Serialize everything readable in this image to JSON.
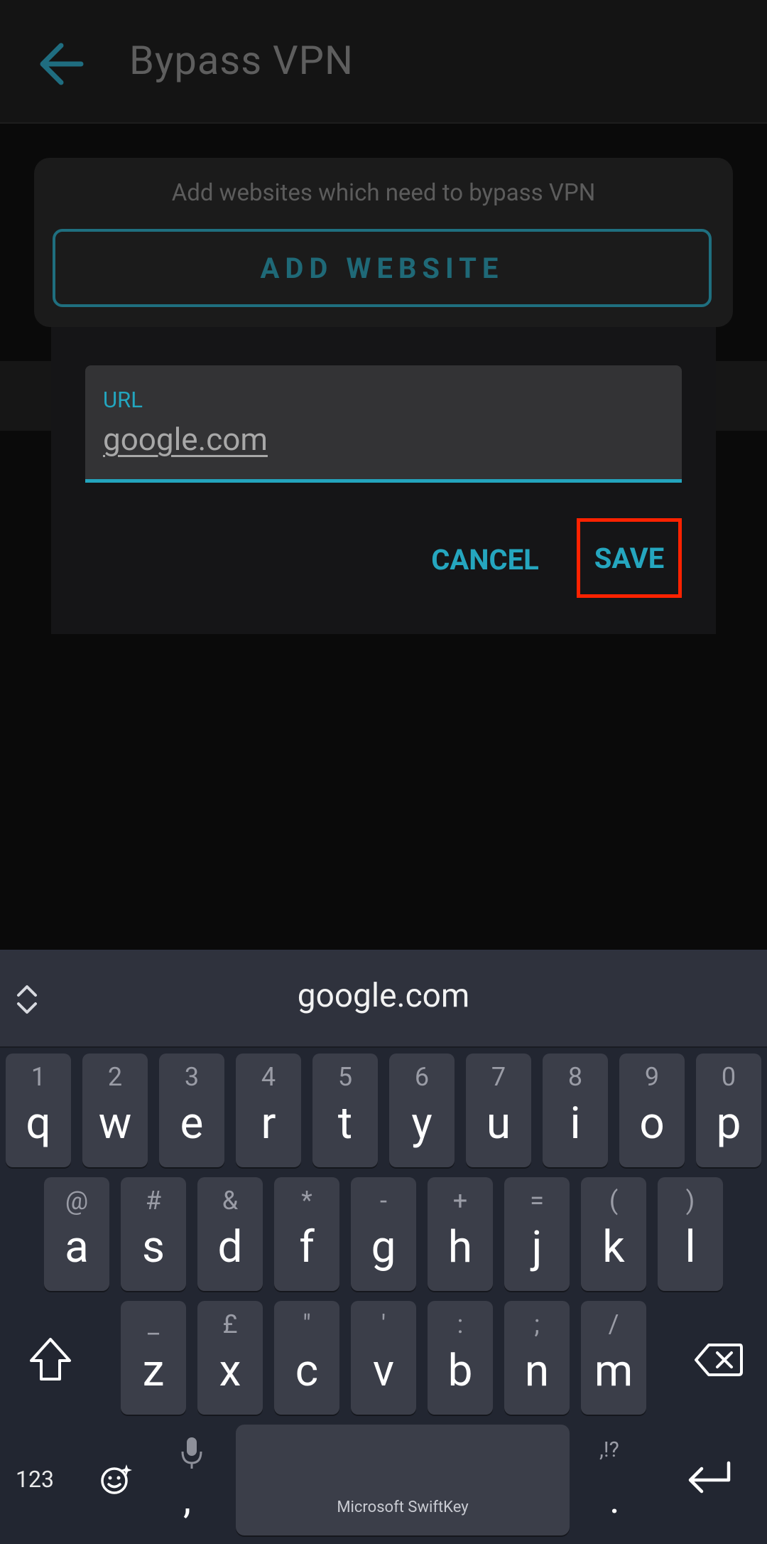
{
  "appbar": {
    "title": "Bypass VPN"
  },
  "card": {
    "hint": "Add websites which need to bypass VPN",
    "add_button": "ADD WEBSITE"
  },
  "dialog": {
    "field_label": "URL",
    "field_value": "google.com",
    "cancel_label": "CANCEL",
    "save_label": "SAVE"
  },
  "keyboard": {
    "suggestion": "google.com",
    "row1": [
      {
        "main": "q",
        "hint": "1"
      },
      {
        "main": "w",
        "hint": "2"
      },
      {
        "main": "e",
        "hint": "3"
      },
      {
        "main": "r",
        "hint": "4"
      },
      {
        "main": "t",
        "hint": "5"
      },
      {
        "main": "y",
        "hint": "6"
      },
      {
        "main": "u",
        "hint": "7"
      },
      {
        "main": "i",
        "hint": "8"
      },
      {
        "main": "o",
        "hint": "9"
      },
      {
        "main": "p",
        "hint": "0"
      }
    ],
    "row2": [
      {
        "main": "a",
        "hint": "@"
      },
      {
        "main": "s",
        "hint": "#"
      },
      {
        "main": "d",
        "hint": "&"
      },
      {
        "main": "f",
        "hint": "*"
      },
      {
        "main": "g",
        "hint": "-"
      },
      {
        "main": "h",
        "hint": "+"
      },
      {
        "main": "j",
        "hint": "="
      },
      {
        "main": "k",
        "hint": "("
      },
      {
        "main": "l",
        "hint": ")"
      }
    ],
    "row3": [
      {
        "main": "z",
        "hint": "_"
      },
      {
        "main": "x",
        "hint": "£"
      },
      {
        "main": "c",
        "hint": "\""
      },
      {
        "main": "v",
        "hint": "'"
      },
      {
        "main": "b",
        "hint": ":"
      },
      {
        "main": "n",
        "hint": ";"
      },
      {
        "main": "m",
        "hint": "/"
      }
    ],
    "numbers_label": "123",
    "comma": ",",
    "period": ".",
    "period_hint": ",!?",
    "space_label": "Microsoft SwiftKey",
    "icons": {
      "back": "arrow-left-icon",
      "expand": "expand-collapse-icon",
      "shift": "shift-icon",
      "backspace": "backspace-icon",
      "emoji": "emoji-sparkle-icon",
      "mic": "microphone-icon",
      "enter": "enter-icon"
    }
  },
  "colors": {
    "accent": "#23a6bf",
    "highlight": "#ff2200",
    "keyboard_bg": "#222631",
    "key_bg": "#3b3e49"
  }
}
